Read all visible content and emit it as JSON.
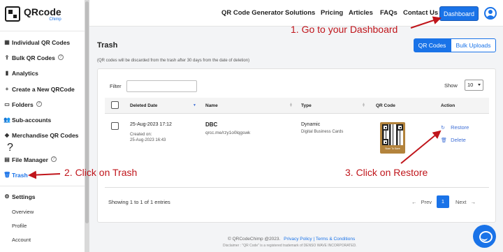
{
  "logo": {
    "title": "QRcode",
    "sub": "Chimp"
  },
  "sidebar": {
    "items": [
      {
        "label": "Individual QR Codes",
        "icon": "grid-icon"
      },
      {
        "label": "Bulk QR Codes",
        "icon": "upload-icon"
      },
      {
        "label": "Analytics",
        "icon": "chart-icon"
      },
      {
        "label": "Create a New QRCode",
        "icon": "plus-icon"
      },
      {
        "label": "Folders",
        "icon": "folder-icon"
      },
      {
        "label": "Sub-accounts",
        "icon": "users-icon"
      },
      {
        "label": "Merchandise QR Codes",
        "icon": "tag-icon"
      },
      {
        "label": "File Manager",
        "icon": "file-icon"
      },
      {
        "label": "Trash",
        "icon": "trash-icon"
      }
    ],
    "settings": {
      "label": "Settings",
      "icon": "gear-icon"
    },
    "settings_sub": [
      "Overview",
      "Profile",
      "Account"
    ]
  },
  "topnav": {
    "links": [
      "QR Code Generator",
      "Solutions",
      "Pricing",
      "Articles",
      "FAQs",
      "Contact Us"
    ],
    "dashboard": "Dashboard"
  },
  "main": {
    "title": "Trash",
    "tabs": [
      "QR Codes",
      "Bulk Uploads"
    ],
    "note": "(QR codes will be discarded from the trash after 30 days from the date of deletion)",
    "filter_label": "Filter",
    "filter_value": "",
    "show_label": "Show",
    "show_value": "10",
    "columns": [
      "Deleted Date",
      "Name",
      "Type",
      "QR Code",
      "Action"
    ],
    "rows": [
      {
        "deleted_date": "25-Aug-2023 17:12",
        "created_label": "Created on:",
        "created_date": "25-Aug-2023 16:43",
        "name": "DBC",
        "url": "qrcc.me/rzy1o0lqgswk",
        "type": "Dynamic",
        "subtype": "Digital Business Cards",
        "qr_caption": "Scan To Save",
        "actions": [
          "Restore",
          "Delete"
        ]
      }
    ],
    "showing": "Showing 1 to 1 of 1 entries",
    "prev": "Prev",
    "page": "1",
    "next": "Next"
  },
  "footer": {
    "copyright": "© QRCodeChimp @2023.",
    "privacy": "Privacy Policy",
    "sep": "|",
    "terms": "Terms & Conditions",
    "disclaimer": "Disclaimer : \"QR Code\" is a registered trademark of DENSO WAVE INCORPORATED."
  },
  "annotations": {
    "step1": "1. Go to your Dashboard",
    "step2": "2. Click on Trash",
    "step3": "3. Click on Restore"
  },
  "colors": {
    "accent": "#1a73e8",
    "annotation": "#c0151b",
    "qr_frame": "#b3833c"
  }
}
